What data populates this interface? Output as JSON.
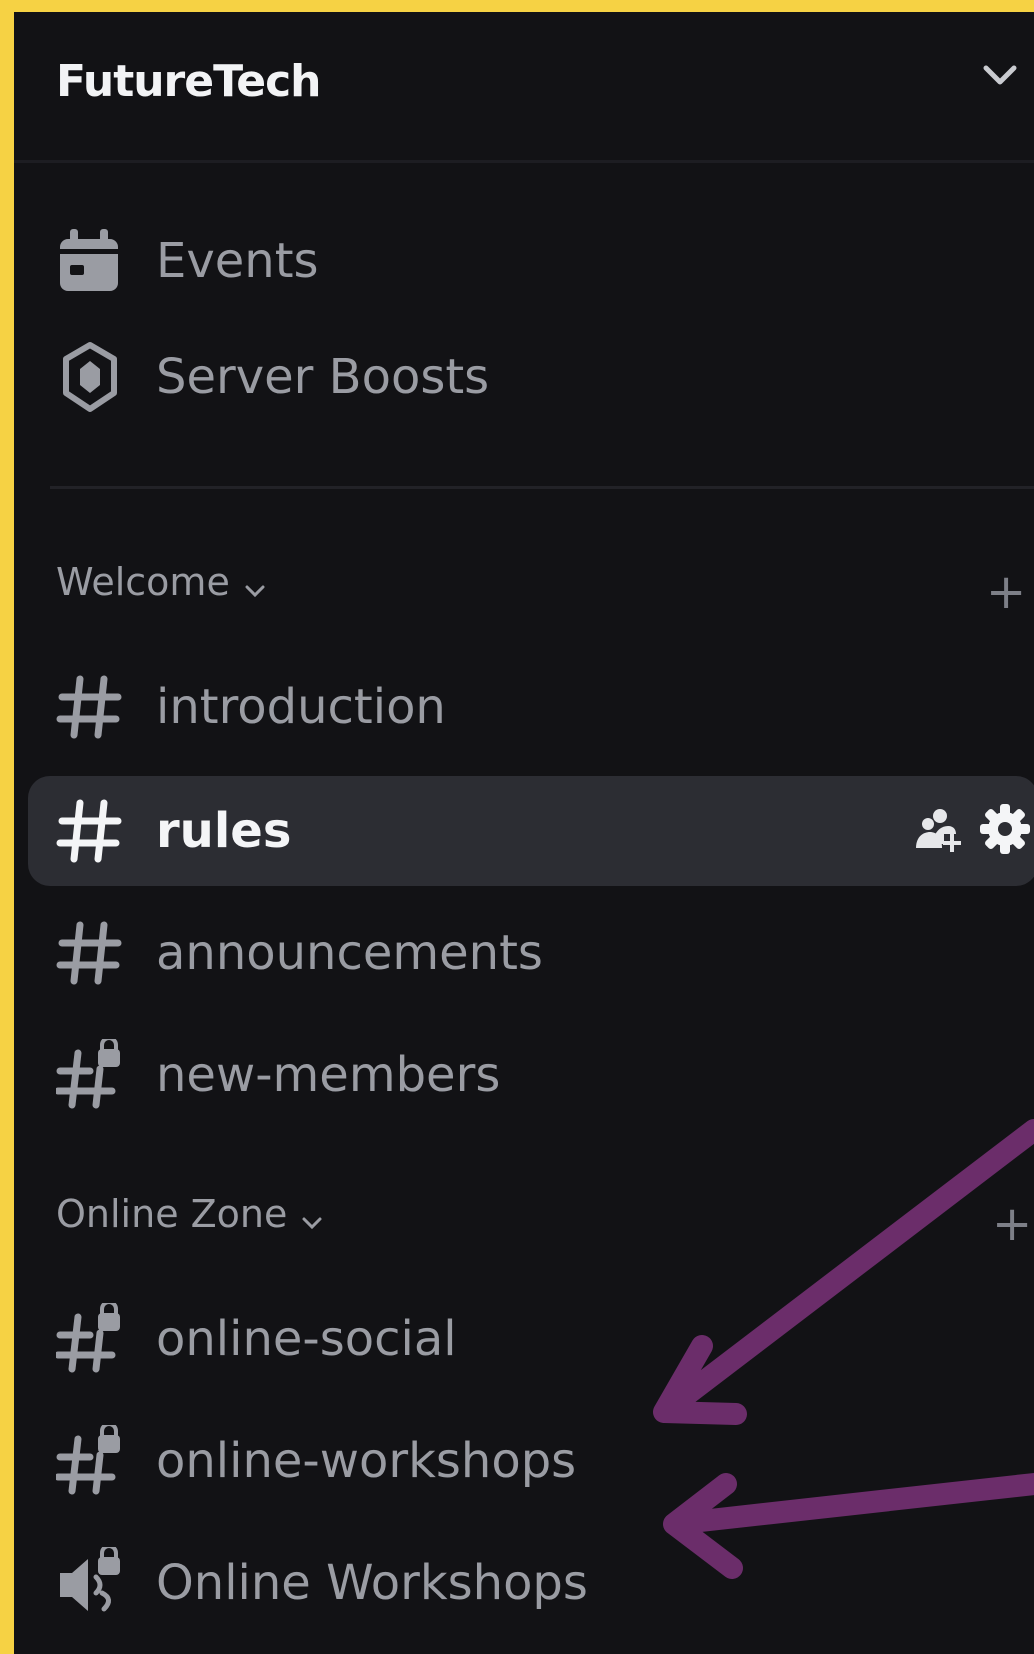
{
  "server": {
    "name": "FutureTech"
  },
  "top_items": [
    {
      "label": "Events",
      "icon": "calendar-icon"
    },
    {
      "label": "Server Boosts",
      "icon": "boost-icon"
    }
  ],
  "categories": [
    {
      "name": "Welcome",
      "channels": [
        {
          "name": "introduction",
          "icon": "hashtag-icon"
        },
        {
          "name": "rules",
          "icon": "hashtag-icon",
          "active": true
        },
        {
          "name": "announcements",
          "icon": "hashtag-icon"
        },
        {
          "name": "new-members",
          "icon": "locked-hashtag-icon"
        }
      ]
    },
    {
      "name": "Online Zone",
      "channels": [
        {
          "name": "online-social",
          "icon": "locked-hashtag-icon"
        },
        {
          "name": "online-workshops",
          "icon": "locked-hashtag-icon"
        },
        {
          "name": "Online Workshops",
          "icon": "locked-speaker-icon"
        }
      ]
    }
  ],
  "colors": {
    "frame": "#f6d244",
    "sidebar_bg": "#121215",
    "active_bg": "#2c2d33",
    "text_muted": "#9a9ca3",
    "text_active": "#f4f5f7",
    "annotation_arrow": "#6b2d6a"
  }
}
